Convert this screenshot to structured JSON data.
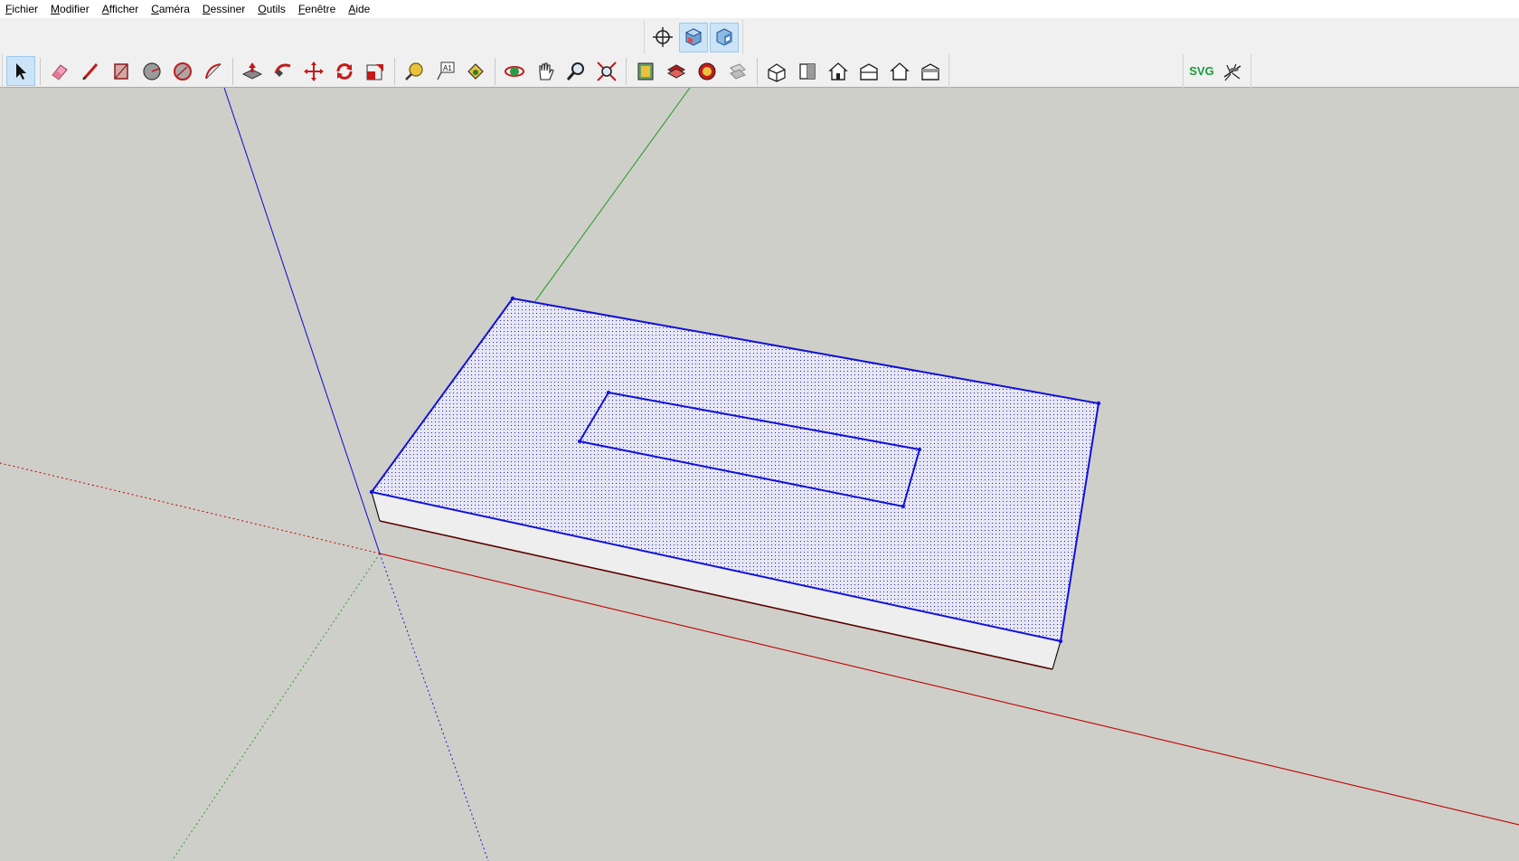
{
  "menubar": {
    "items": [
      "Fichier",
      "Modifier",
      "Afficher",
      "Caméra",
      "Dessiner",
      "Outils",
      "Fenêtre",
      "Aide"
    ]
  },
  "toolbar": {
    "views_group": [
      "crosshair-icon",
      "iso-view-icon",
      "iso-view-alt-icon"
    ],
    "active_tool": "select-arrow-icon",
    "plugins": {
      "svg_label": "SVG"
    }
  },
  "scene": {
    "axis_colors": {
      "red": "#c00000",
      "green": "#2e9e2e",
      "blue": "#1a1ad0"
    },
    "selection_color": "#1010dd",
    "face_fill": "#e6e6f4",
    "side_fill": "#eeeeee",
    "background": "#cfcfc9"
  }
}
